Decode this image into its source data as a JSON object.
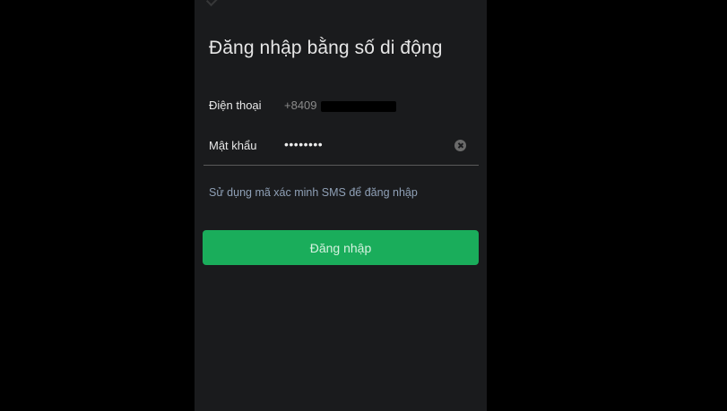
{
  "screen": {
    "title": "Đăng nhập bằng số di động"
  },
  "form": {
    "phone_label": "Điện thoại",
    "phone_value": "+8409",
    "password_label": "Mật khẩu",
    "password_value": "••••••••",
    "clear_icon": "clear-circle-icon"
  },
  "sms_link": "Sử dụng mã xác minh SMS để đăng nhập",
  "login_button": "Đăng nhập",
  "colors": {
    "accent": "#1aad5b",
    "background": "#1a1b1d",
    "link": "#8fa0b6"
  }
}
